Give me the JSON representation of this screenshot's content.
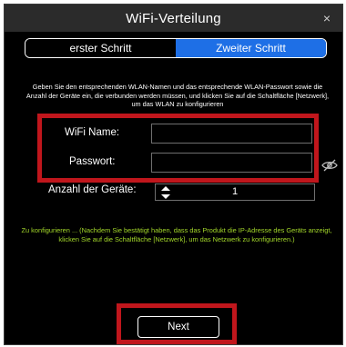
{
  "window": {
    "title": "WiFi-Verteilung",
    "close_symbol": "×"
  },
  "tabs": [
    {
      "label": "erster Schritt",
      "active": false
    },
    {
      "label": "Zweiter Schritt",
      "active": true
    }
  ],
  "instructions": "Geben Sie den entsprechenden WLAN-Namen und das entsprechende WLAN-Passwort sowie die Anzahl der Geräte ein, die verbunden werden müssen, und klicken Sie auf die Schaltfläche [Netzwerk], um das WLAN zu konfigurieren",
  "form": {
    "wifi_name_label": "WiFi Name:",
    "wifi_name_value": "",
    "password_label": "Passwort:",
    "password_value": "",
    "device_count_label": "Anzahl der Geräte:",
    "device_count_value": "1"
  },
  "note": "Zu konfigurieren ... (Nachdem Sie bestätigt haben, dass das Produkt die IP-Adresse des Geräts anzeigt, klicken Sie auf die Schaltfläche [Netzwerk], um das Netzwerk zu konfigurieren.)",
  "actions": {
    "next_label": "Next"
  },
  "colors": {
    "accent": "#1e6fe6",
    "highlight": "#c0161c",
    "note_text": "#a3d72a",
    "background": "#000000"
  },
  "icons": {
    "close": "close-icon",
    "eye": "eye-slash-icon",
    "stepper": "stepper-arrows-icon"
  }
}
